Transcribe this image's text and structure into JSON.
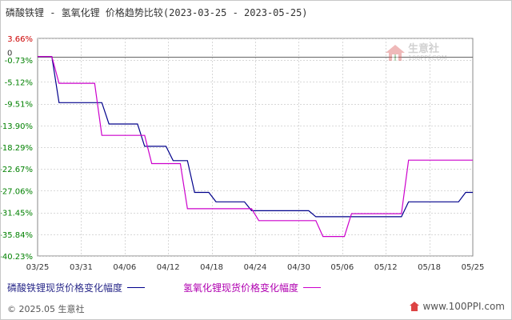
{
  "chart_data": {
    "type": "line",
    "title": "磷酸铁锂 - 氢氧化锂 价格趋势比较(2023-03-25 - 2023-05-25)",
    "x": [
      "03/25",
      "03/31",
      "04/06",
      "04/12",
      "04/18",
      "04/24",
      "04/30",
      "05/06",
      "05/12",
      "05/18",
      "05/25"
    ],
    "y_ticks": [
      "3.66%",
      "0",
      "-0.73%",
      "-5.12%",
      "-9.51%",
      "-13.90%",
      "-18.29%",
      "-22.67%",
      "-27.06%",
      "-31.45%",
      "-35.84%",
      "-40.23%"
    ],
    "ylim": [
      -40.23,
      3.66
    ],
    "grid": true,
    "legend_position": "bottom",
    "series": [
      {
        "name": "磷酸铁锂现货价格变化幅度",
        "color": "#00008b",
        "points": [
          [
            "2023-03-25",
            0
          ],
          [
            "2023-03-27",
            0
          ],
          [
            "2023-03-28",
            -9.3
          ],
          [
            "2023-04-03",
            -9.3
          ],
          [
            "2023-04-04",
            -13.6
          ],
          [
            "2023-04-08",
            -13.6
          ],
          [
            "2023-04-09",
            -18.1
          ],
          [
            "2023-04-12",
            -18.1
          ],
          [
            "2023-04-13",
            -21.0
          ],
          [
            "2023-04-15",
            -21.0
          ],
          [
            "2023-04-16",
            -27.4
          ],
          [
            "2023-04-18",
            -27.4
          ],
          [
            "2023-04-19",
            -29.3
          ],
          [
            "2023-04-23",
            -29.3
          ],
          [
            "2023-04-24",
            -31.1
          ],
          [
            "2023-05-02",
            -31.1
          ],
          [
            "2023-05-03",
            -32.3
          ],
          [
            "2023-05-15",
            -32.3
          ],
          [
            "2023-05-16",
            -29.3
          ],
          [
            "2023-05-23",
            -29.3
          ],
          [
            "2023-05-24",
            -27.4
          ],
          [
            "2023-05-25",
            -27.4
          ]
        ]
      },
      {
        "name": "氢氧化锂现货价格变化幅度",
        "color": "#cc00cc",
        "points": [
          [
            "2023-03-25",
            0
          ],
          [
            "2023-03-27",
            0
          ],
          [
            "2023-03-28",
            -5.4
          ],
          [
            "2023-04-02",
            -5.4
          ],
          [
            "2023-04-03",
            -15.9
          ],
          [
            "2023-04-09",
            -15.9
          ],
          [
            "2023-04-10",
            -21.6
          ],
          [
            "2023-04-14",
            -21.6
          ],
          [
            "2023-04-15",
            -30.7
          ],
          [
            "2023-04-24",
            -30.7
          ],
          [
            "2023-04-25",
            -33.1
          ],
          [
            "2023-05-03",
            -33.1
          ],
          [
            "2023-05-04",
            -36.3
          ],
          [
            "2023-05-07",
            -36.3
          ],
          [
            "2023-05-08",
            -31.7
          ],
          [
            "2023-05-15",
            -31.7
          ],
          [
            "2023-05-16",
            -20.9
          ],
          [
            "2023-05-25",
            -20.9
          ]
        ]
      }
    ]
  },
  "footer": {
    "copyright": "© 2025.05 生意社",
    "website": "www.100PPI.com"
  },
  "watermark": {
    "text": "生意社",
    "url": "100PPI.COM"
  }
}
